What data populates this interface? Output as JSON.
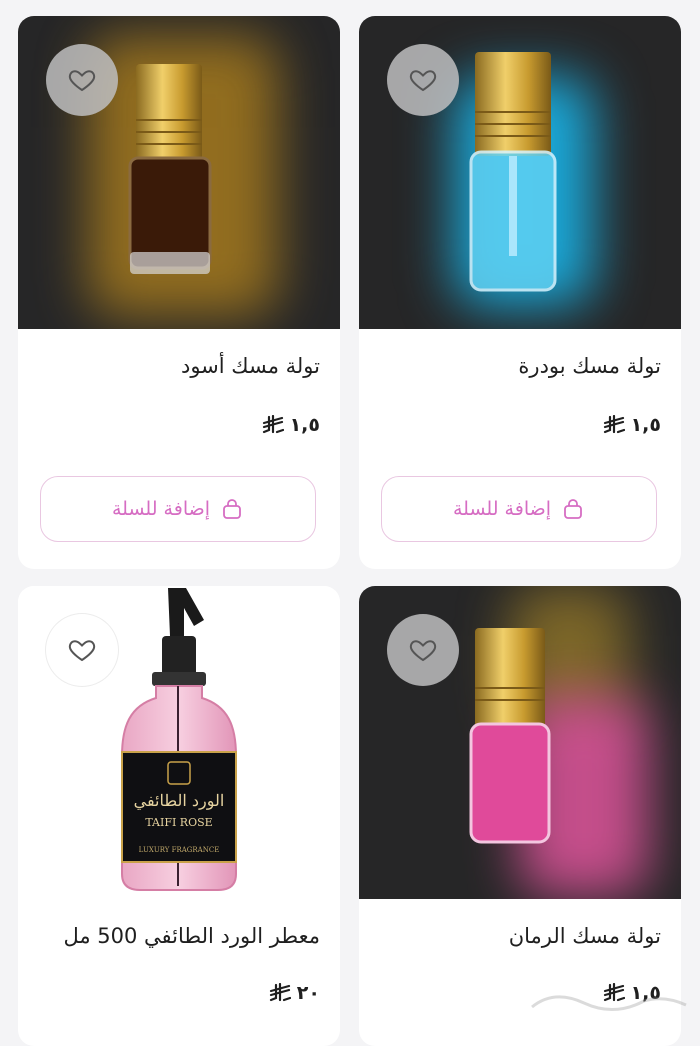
{
  "currency_icon": "riyal-symbol-icon",
  "accent_color": "#d66dc3",
  "products": [
    {
      "title": "تولة مسك بودرة",
      "price": "١,٥",
      "add_to_cart": "إضافة للسلة",
      "image": "blue-perfume-bottle"
    },
    {
      "title": "تولة مسك أسود",
      "price": "١,٥",
      "add_to_cart": "إضافة للسلة",
      "image": "dark-perfume-bottle"
    },
    {
      "title": "تولة مسك الرمان",
      "price": "١,٥",
      "image": "pink-perfume-bottle"
    },
    {
      "title": "معطر الورد الطائفي 500 مل",
      "price": "٢٠",
      "image": "rose-spray-bottle",
      "bottle_label": {
        "arabic": "الورد الطائفي",
        "english": "TAIFI ROSE",
        "subtitle": "LUXURY FRAGRANCE"
      }
    }
  ]
}
